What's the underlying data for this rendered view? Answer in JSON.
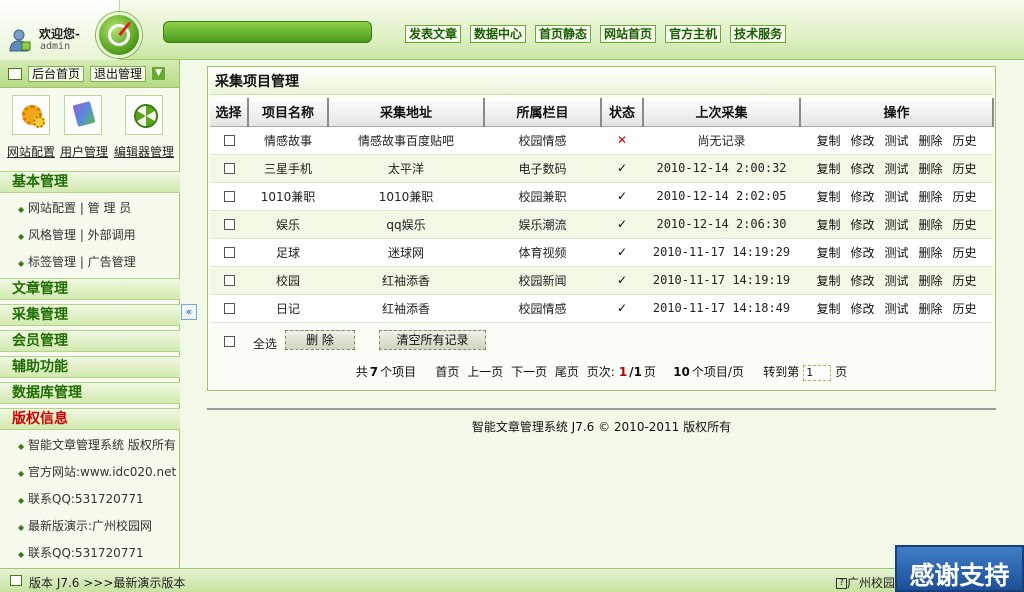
{
  "header": {
    "welcome": "欢迎您-",
    "username": "admin",
    "nav": [
      "发表文章",
      "数据中心",
      "首页静态",
      "网站首页",
      "官方主机",
      "技术服务"
    ]
  },
  "sidebar": {
    "top_buttons": [
      "后台首页",
      "退出管理"
    ],
    "quick": [
      "网站配置",
      "用户管理",
      "编辑器管理"
    ],
    "sections": {
      "basic": "基本管理",
      "article": "文章管理",
      "collect": "采集管理",
      "member": "会员管理",
      "assist": "辅助功能",
      "database": "数据库管理",
      "copyright": "版权信息"
    },
    "basic_items": [
      "网站配置 | 管 理 员",
      "风格管理 | 外部调用",
      "标签管理 | 广告管理"
    ],
    "copyright_items": [
      "智能文章管理系统 版权所有",
      "官方网站:www.idc020.net",
      "联系QQ:531720771",
      "最新版演示:广州校园网",
      "联系QQ:531720771"
    ]
  },
  "panel": {
    "title": "采集项目管理",
    "columns": [
      "选择",
      "项目名称",
      "采集地址",
      "所属栏目",
      "状态",
      "上次采集",
      "操作"
    ],
    "ops": [
      "复制",
      "修改",
      "测试",
      "删除",
      "历史"
    ],
    "rows": [
      {
        "name": "情感故事",
        "addr": "情感故事百度贴吧",
        "cat": "校园情感",
        "status": "✕",
        "last": "尚无记录"
      },
      {
        "name": "三星手机",
        "addr": "太平洋",
        "cat": "电子数码",
        "status": "✓",
        "last": "2010-12-14 2:00:32"
      },
      {
        "name": "1010兼职",
        "addr": "1010兼职",
        "cat": "校园兼职",
        "status": "✓",
        "last": "2010-12-14 2:02:05"
      },
      {
        "name": "娱乐",
        "addr": "qq娱乐",
        "cat": "娱乐潮流",
        "status": "✓",
        "last": "2010-12-14 2:06:30"
      },
      {
        "name": "足球",
        "addr": "迷球网",
        "cat": "体育视频",
        "status": "✓",
        "last": "2010-11-17 14:19:29"
      },
      {
        "name": "校园",
        "addr": "红袖添香",
        "cat": "校园新闻",
        "status": "✓",
        "last": "2010-11-17 14:19:19"
      },
      {
        "name": "日记",
        "addr": "红袖添香",
        "cat": "校园情感",
        "status": "✓",
        "last": "2010-11-17 14:18:49"
      }
    ],
    "select_all": "全选",
    "delete_btn": "删 除",
    "clear_btn": "清空所有记录",
    "pager": {
      "total_pre": "共",
      "total": "7",
      "total_post": "个项目",
      "first": "首页",
      "prev": "上一页",
      "next": "下一页",
      "last": "尾页",
      "page_label": "页次:",
      "page_cur": "1",
      "page_sep": "/",
      "page_total": "1",
      "page_suffix": "页",
      "per_page": "10",
      "per_page_post": "个项目/页",
      "goto_pre": "转到第",
      "goto_value": "1",
      "goto_post": "页"
    }
  },
  "copyright": "智能文章管理系统 J7.6 © 2010-2011 版权所有",
  "status": {
    "left": "版本 J7.6 >>>最新演示版本",
    "right": "广州校园",
    "thanks": "感谢支持"
  }
}
